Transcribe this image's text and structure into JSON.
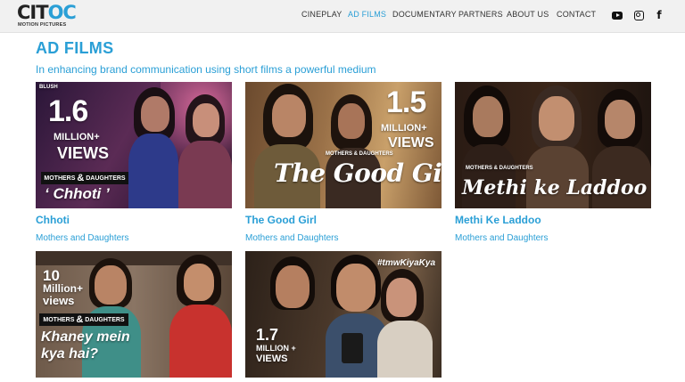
{
  "logo": {
    "text_a": "CIT",
    "text_b": "OC",
    "tagline": "MOTION PICTURES"
  },
  "nav": [
    "CINEPLAY",
    "AD FILMS",
    "DOCUMENTARY",
    "PARTNERS",
    "ABOUT US",
    "CONTACT"
  ],
  "social": [
    "youtube-icon",
    "instagram-icon",
    "facebook-icon"
  ],
  "page": {
    "title": "AD FILMS",
    "subtitle": "In enhancing brand communication using short films a powerful medium"
  },
  "colors": {
    "accent": "#2a9fd6",
    "topbar": "#f1f1f1"
  },
  "films": [
    {
      "title": "Chhoti",
      "subtitle": "Mothers and Daughters",
      "poster": {
        "badge": "BLUSH",
        "num": "1.6",
        "unit": "MILLION",
        "sup": "+",
        "views": "VIEWS",
        "brand_a": "MOTHERS",
        "amp": "&",
        "brand_b": "DAUGHTERS",
        "name": "‘ Chhoti ’"
      }
    },
    {
      "title": "The Good Girl",
      "subtitle": "Mothers and Daughters",
      "poster": {
        "num": "1.5",
        "unit": "MILLION",
        "sup": "+",
        "views": "VIEWS",
        "brand": "MOTHERS & DAUGHTERS",
        "name": "The Good Girl"
      }
    },
    {
      "title": "Methi Ke Laddoo",
      "subtitle": "Mothers and Daughters",
      "poster": {
        "brand": "MOTHERS & DAUGHTERS",
        "name": "Methi ke Laddoo"
      }
    },
    {
      "poster": {
        "num": "10",
        "unit": "Million+",
        "views": "views",
        "brand_a": "MOTHERS",
        "amp": "&",
        "brand_b": "DAUGHTERS",
        "line1": "Khaney mein",
        "line2": "kya hai?"
      }
    },
    {
      "poster": {
        "hashtag": "#tmwKiyaKya",
        "num": "1.7",
        "unit": "MILLION +",
        "views": "VIEWS"
      }
    }
  ]
}
